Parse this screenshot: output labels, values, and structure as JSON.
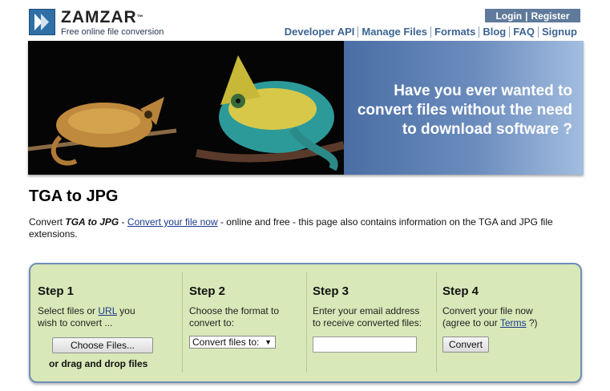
{
  "brand": {
    "name": "ZAMZAR",
    "tm": "™",
    "tagline": "Free online file conversion"
  },
  "account": {
    "login": "Login",
    "separator": "|",
    "register": "Register"
  },
  "nav": [
    "Developer API",
    "Manage Files",
    "Formats",
    "Blog",
    "FAQ",
    "Signup"
  ],
  "banner": {
    "line1": "Have you ever wanted to",
    "line2": "convert files without the need",
    "line3": "to download software ?"
  },
  "page": {
    "title": "TGA to JPG",
    "desc_prefix": "Convert ",
    "desc_bold": "TGA to JPG",
    "desc_sep": " - ",
    "desc_link": "Convert your file now",
    "desc_suffix": " - online and free - this page also contains information on the TGA and JPG file extensions."
  },
  "steps": {
    "step1": {
      "title": "Step 1",
      "text_a": "Select files or ",
      "link": "URL",
      "text_b": " you",
      "text_c": "wish to convert ...",
      "button": "Choose Files...",
      "drag": "or drag and drop files"
    },
    "step2": {
      "title": "Step 2",
      "line1": "Choose the format to",
      "line2": "convert to:",
      "select": "Convert files to:"
    },
    "step3": {
      "title": "Step 3",
      "line1": "Enter your email address",
      "line2": "to receive converted files:",
      "email_value": ""
    },
    "step4": {
      "title": "Step 4",
      "line1": "Convert your file now",
      "line2a": "(agree to our ",
      "terms": "Terms",
      "line2b": " ?)",
      "button": "Convert"
    }
  },
  "colors": {
    "accent": "#3c6493",
    "panel": "#d8e8b8",
    "banner_blue": "#5f7fb2"
  }
}
